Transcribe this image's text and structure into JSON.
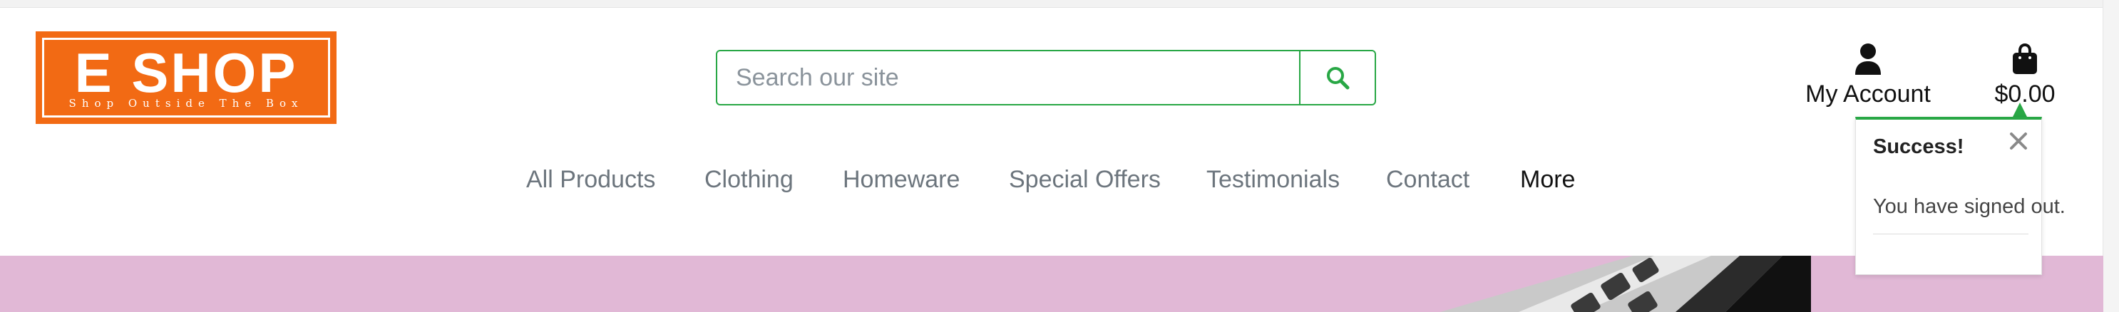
{
  "header": {
    "logo": {
      "title": "E SHOP",
      "tagline": "Shop Outside The Box",
      "color": "#f26a14"
    },
    "search": {
      "placeholder": "Search our site",
      "value": "",
      "button_icon": "search-icon",
      "accent": "#28a745"
    },
    "account": {
      "label": "My Account",
      "icon": "user-icon"
    },
    "cart": {
      "total": "$0.00",
      "icon": "shopping-bag-icon"
    }
  },
  "nav": {
    "items": [
      {
        "label": "All Products"
      },
      {
        "label": "Clothing"
      },
      {
        "label": "Homeware"
      },
      {
        "label": "Special Offers"
      },
      {
        "label": "Testimonials"
      },
      {
        "label": "Contact"
      },
      {
        "label": "More"
      }
    ]
  },
  "toast": {
    "title": "Success!",
    "message": "You have signed out.",
    "close_icon": "close-icon",
    "accent": "#28a745"
  },
  "hero": {
    "background": "#e1b8d6"
  }
}
